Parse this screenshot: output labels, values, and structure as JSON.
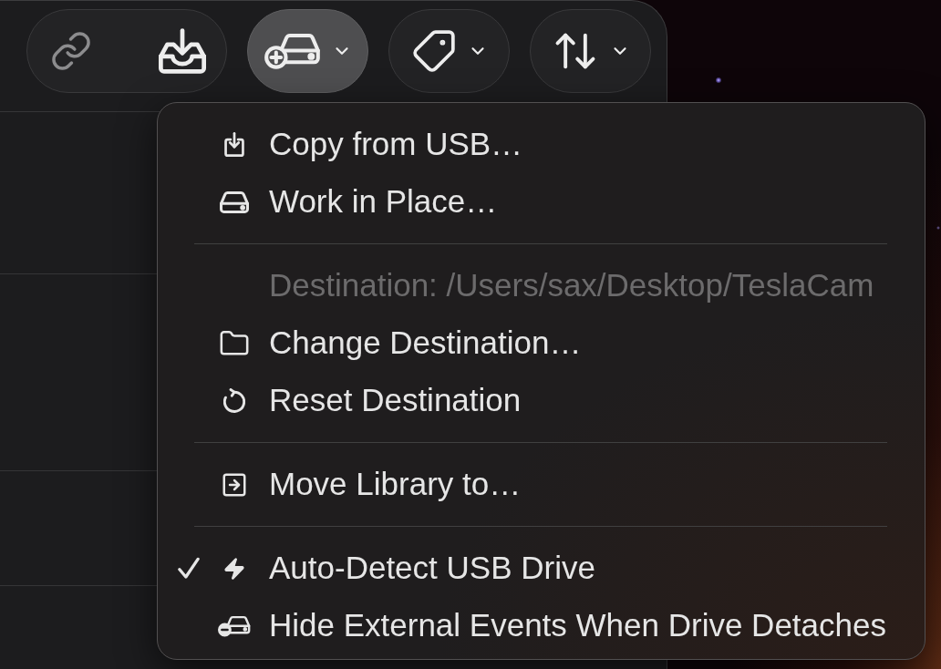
{
  "toolbar": {
    "groups": [
      {
        "buttons": [
          {
            "kind": "link",
            "disabled": true,
            "expanded": false
          },
          {
            "kind": "import",
            "disabled": false,
            "expanded": false
          }
        ]
      },
      {
        "buttons": [
          {
            "kind": "drive_menu",
            "disabled": false,
            "expanded": true
          }
        ]
      },
      {
        "buttons": [
          {
            "kind": "tag_menu",
            "disabled": false,
            "expanded": false
          }
        ]
      },
      {
        "buttons": [
          {
            "kind": "sort_menu",
            "disabled": false,
            "expanded": false
          }
        ]
      }
    ]
  },
  "menu": {
    "items": [
      {
        "kind": "item",
        "label": "Copy from USB…",
        "disabled": false,
        "checked": false
      },
      {
        "kind": "item",
        "label": "Work in Place…",
        "disabled": false,
        "checked": false
      },
      {
        "kind": "separator"
      },
      {
        "kind": "item",
        "label": "Destination: /Users/sax/Desktop/TeslaCam",
        "disabled": true,
        "checked": false
      },
      {
        "kind": "item",
        "label": "Change Destination…",
        "disabled": false,
        "checked": false
      },
      {
        "kind": "item",
        "label": "Reset Destination",
        "disabled": false,
        "checked": false
      },
      {
        "kind": "separator"
      },
      {
        "kind": "item",
        "label": "Move Library to…",
        "disabled": false,
        "checked": false
      },
      {
        "kind": "separator"
      },
      {
        "kind": "item",
        "label": "Auto-Detect USB Drive",
        "disabled": false,
        "checked": true
      },
      {
        "kind": "item",
        "label": "Hide External Events When Drive Detaches",
        "disabled": false,
        "checked": false
      }
    ]
  }
}
